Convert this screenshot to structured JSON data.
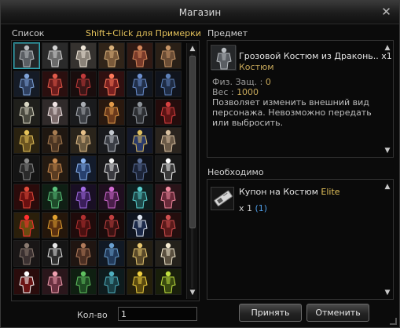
{
  "window": {
    "title": "Магазин",
    "close_symbol": "✕"
  },
  "list": {
    "label": "Список",
    "hint": "Shift+Click для Примерки",
    "slots": [
      {
        "icon": "dark-armor-set-icon",
        "color": "#5a5e63",
        "accent": "#b8bcc0",
        "selected": true
      },
      {
        "icon": "plate-armor-set-icon",
        "color": "#6a6a6a",
        "accent": "#d2d2d2"
      },
      {
        "icon": "white-armor-set-icon",
        "color": "#8a8278",
        "accent": "#efe6d8"
      },
      {
        "icon": "bronze-armor-set-icon",
        "color": "#7a5a3a",
        "accent": "#d8b07a"
      },
      {
        "icon": "crimson-armor-set-icon",
        "color": "#7a3b2a",
        "accent": "#d5865a"
      },
      {
        "icon": "brown-armor-set-icon",
        "color": "#6b4d35",
        "accent": "#c69466"
      },
      {
        "icon": "blue-armor-set-icon",
        "color": "#2e3f5f",
        "accent": "#7fa3d8"
      },
      {
        "icon": "red-armor-set-icon",
        "color": "#6a1c1c",
        "accent": "#e05a4a"
      },
      {
        "icon": "black-red-armor-set-icon",
        "color": "#3a1616",
        "accent": "#c03a3a"
      },
      {
        "icon": "scarlet-armor-set-icon",
        "color": "#7a2020",
        "accent": "#ff7a5a"
      },
      {
        "icon": "dark-blue-armor-set-icon",
        "color": "#22304a",
        "accent": "#6c8fcf"
      },
      {
        "icon": "navy-armor-set-icon",
        "color": "#1f2c44",
        "accent": "#5d80b8"
      },
      {
        "icon": "skeleton-armor-set-icon",
        "color": "#4a4a40",
        "accent": "#d8d6c2"
      },
      {
        "icon": "white-dress-costume-icon",
        "color": "#7a6a6a",
        "accent": "#f0e4e4"
      },
      {
        "icon": "steel-armor-set-icon",
        "color": "#3c3f44",
        "accent": "#a9adb3"
      },
      {
        "icon": "gold-red-armor-set-icon",
        "color": "#6b3a1c",
        "accent": "#e29a4a"
      },
      {
        "icon": "dark-steel-armor-set-icon",
        "color": "#2d2f33",
        "accent": "#8e949b"
      },
      {
        "icon": "red-cloak-costume-icon",
        "color": "#5a1414",
        "accent": "#d64040"
      },
      {
        "icon": "gold-armor-set-icon",
        "color": "#6a5320",
        "accent": "#e5c35a"
      },
      {
        "icon": "leather-armor-set-icon",
        "color": "#4a3422",
        "accent": "#a87d52"
      },
      {
        "icon": "swimsuit-costume-icon",
        "color": "#6a5a40",
        "accent": "#e6c08a"
      },
      {
        "icon": "knight-armor-set-icon",
        "color": "#3a3d44",
        "accent": "#c4c8cf"
      },
      {
        "icon": "blue-gold-costume-icon",
        "color": "#2a3a6a",
        "accent": "#e0c060"
      },
      {
        "icon": "tan-costume-icon",
        "color": "#6a5a48",
        "accent": "#d8c0a0"
      },
      {
        "icon": "black-dress-costume-icon",
        "color": "#2a2a2a",
        "accent": "#8a8a8a"
      },
      {
        "icon": "tribal-costume-icon",
        "color": "#5a3c22",
        "accent": "#c88a4e"
      },
      {
        "icon": "blue-dress-costume-icon",
        "color": "#27406e",
        "accent": "#8ab4f0"
      },
      {
        "icon": "maid-costume-icon",
        "color": "#3a3a40",
        "accent": "#f2f2f2"
      },
      {
        "icon": "navy-suit-costume-icon",
        "color": "#1c2438",
        "accent": "#5a6e98"
      },
      {
        "icon": "sale-badge-icon",
        "color": "#3a3a3a",
        "accent": "#ffffff"
      },
      {
        "icon": "red-qipao-costume-icon",
        "color": "#6a1010",
        "accent": "#e04a3a"
      },
      {
        "icon": "green-qipao-costume-icon",
        "color": "#1e4a2a",
        "accent": "#5ac07a"
      },
      {
        "icon": "purple-qipao-costume-icon",
        "color": "#3a1e5a",
        "accent": "#a06ae0"
      },
      {
        "icon": "violet-qipao-costume-icon",
        "color": "#4a1e4a",
        "accent": "#d06ad0"
      },
      {
        "icon": "teal-qipao-costume-icon",
        "color": "#1e4a4a",
        "accent": "#5ad0d0"
      },
      {
        "icon": "pink-qipao-costume-icon",
        "color": "#6a2a3a",
        "accent": "#f08aa0"
      },
      {
        "icon": "heart-costume-icon",
        "color": "#6a4a10",
        "accent": "#ff3030"
      },
      {
        "icon": "gold-red-costume-icon",
        "color": "#5a3010",
        "accent": "#e0a030"
      },
      {
        "icon": "dark-red-costume-icon",
        "color": "#4a1010",
        "accent": "#b03030"
      },
      {
        "icon": "red-black-costume-icon",
        "color": "#3a1212",
        "accent": "#c04040"
      },
      {
        "icon": "navy-white-costume-icon",
        "color": "#1c2a4a",
        "accent": "#dde4f0"
      },
      {
        "icon": "crimson-costume-icon",
        "color": "#5a1a1a",
        "accent": "#d05050"
      },
      {
        "icon": "teddy-bear-costume-icon",
        "color": "#3a3030",
        "accent": "#8a7a70"
      },
      {
        "icon": "panda-costume-icon",
        "color": "#2e2e2e",
        "accent": "#e8e8e8"
      },
      {
        "icon": "brown-bear-costume-icon",
        "color": "#4a2e22",
        "accent": "#b07a5a"
      },
      {
        "icon": "blue-coat-costume-icon",
        "color": "#223a5a",
        "accent": "#6aa0d0"
      },
      {
        "icon": "gold-trim-costume-icon",
        "color": "#5a4a2a",
        "accent": "#e8c870"
      },
      {
        "icon": "white-gold-costume-icon",
        "color": "#5a5040",
        "accent": "#f4ead0"
      },
      {
        "icon": "santa-costume-icon",
        "color": "#6a1414",
        "accent": "#ffffff"
      },
      {
        "icon": "pink-hat-costume-icon",
        "color": "#6a3040",
        "accent": "#f0a0b0"
      },
      {
        "icon": "green-robe-costume-icon",
        "color": "#1e4a22",
        "accent": "#60c060"
      },
      {
        "icon": "teal-robe-costume-icon",
        "color": "#1a3e44",
        "accent": "#50b0c0"
      },
      {
        "icon": "yellow-robe-costume-icon",
        "color": "#5a4a10",
        "accent": "#f0d040"
      },
      {
        "icon": "lime-robe-costume-icon",
        "color": "#3a4a10",
        "accent": "#c0e040"
      }
    ]
  },
  "item": {
    "label": "Предмет",
    "name": "Грозовой Костюм из Драконь.. x1",
    "type": "Костюм",
    "def_label": "Физ. Защ. : ",
    "def_value": "0",
    "weight_label": "Вес : ",
    "weight_value": "1000",
    "description": "Позволяет изменить внешний вид персонажа. Невозможно передать или выбросить.",
    "icon": "dark-armor-set-icon"
  },
  "required": {
    "label": "Необходимо",
    "name": "Купон на Костюм ",
    "grade": "Elite",
    "qty": "x 1 ",
    "owned": "(1)",
    "icon": "coupon-icon"
  },
  "quantity": {
    "label": "Кол-во",
    "value": "1"
  },
  "buttons": {
    "accept": "Принять",
    "cancel": "Отменить"
  },
  "scroll": {
    "up": "▲",
    "down": "▼"
  }
}
